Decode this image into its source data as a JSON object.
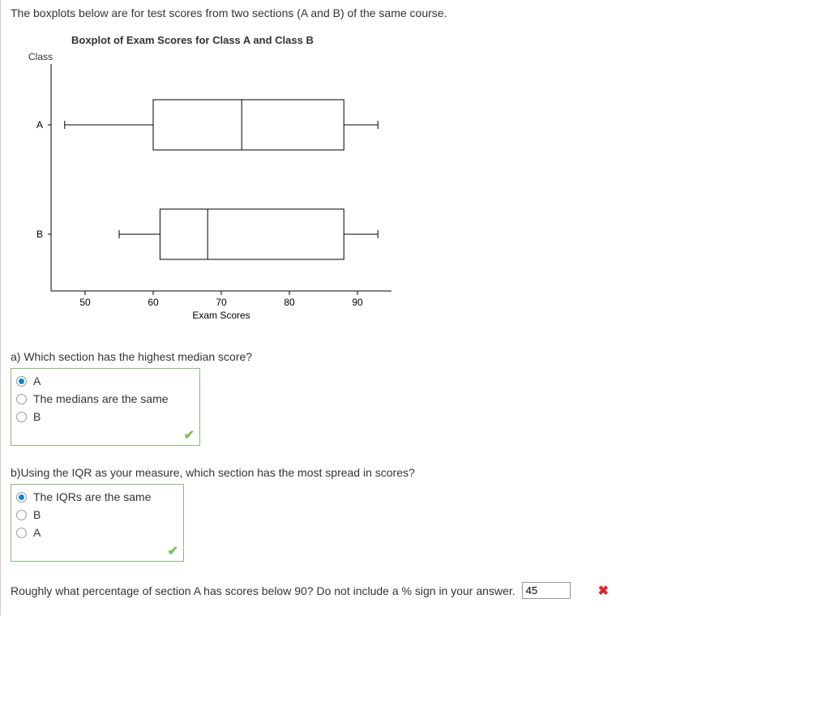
{
  "intro_text": "The boxplots below are for test scores from two sections (A and B) of the same course.",
  "chart_data": {
    "type": "boxplot",
    "title": "Boxplot of Exam Scores for Class A and Class B",
    "xlabel": "Exam Scores",
    "ylabel": "Class",
    "xlim": [
      45,
      95
    ],
    "x_ticks": [
      50,
      60,
      70,
      80,
      90
    ],
    "categories": [
      "A",
      "B"
    ],
    "series": [
      {
        "name": "A",
        "min": 47,
        "q1": 60,
        "median": 73,
        "q3": 88,
        "max": 93
      },
      {
        "name": "B",
        "min": 55,
        "q1": 61,
        "median": 68,
        "q3": 88,
        "max": 93
      }
    ]
  },
  "questions": {
    "a": {
      "prompt": "a) Which section has the highest median score?",
      "options": [
        "A",
        "The medians are the same",
        "B"
      ],
      "selected_index": 0,
      "correct": true
    },
    "b": {
      "prompt": "b)Using the IQR as your measure, which section has the most spread in scores?",
      "options": [
        "The IQRs are the same",
        "B",
        "A"
      ],
      "selected_index": 0,
      "correct": true
    },
    "c": {
      "prompt": "Roughly what percentage of section A has scores below 90? Do not include a % sign in your answer.",
      "entered_value": "45",
      "correct": false
    }
  }
}
